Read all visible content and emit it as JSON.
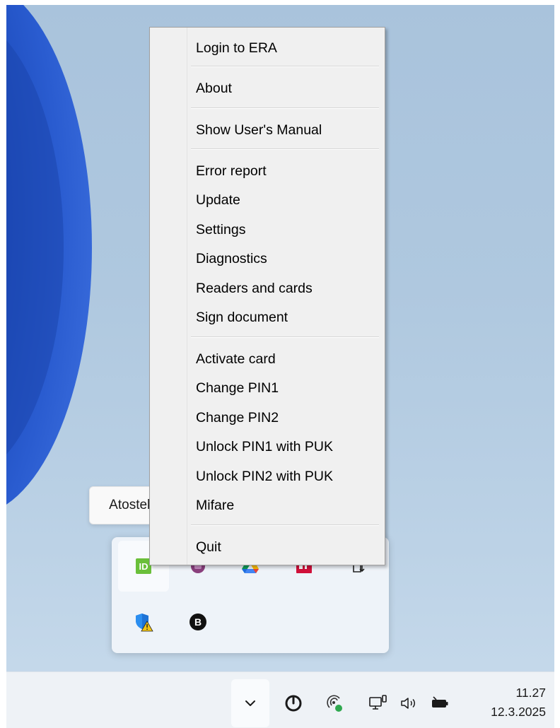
{
  "context_menu": {
    "items": [
      {
        "label": "Login to ERA"
      },
      {
        "label": "About"
      },
      {
        "label": "Show User's Manual"
      },
      {
        "label": "Error report"
      },
      {
        "label": "Update"
      },
      {
        "label": "Settings"
      },
      {
        "label": "Diagnostics"
      },
      {
        "label": "Readers and cards"
      },
      {
        "label": "Sign document"
      },
      {
        "label": "Activate card"
      },
      {
        "label": "Change PIN1"
      },
      {
        "label": "Change PIN2"
      },
      {
        "label": "Unlock PIN1 with PUK"
      },
      {
        "label": "Unlock PIN2 with PUK"
      },
      {
        "label": "Mifare"
      },
      {
        "label": "Quit"
      }
    ]
  },
  "tooltip": {
    "text": "Atostek ID"
  },
  "tray_flyout": {
    "icons": [
      {
        "name": "atostek-id-icon",
        "glyph": "ID",
        "color": "#6abf3a",
        "hovered": true
      },
      {
        "name": "purple-app-icon",
        "color": "#8a3f7d"
      },
      {
        "name": "google-drive-icon"
      },
      {
        "name": "red-app-icon",
        "color": "#d0103a"
      },
      {
        "name": "device-download-icon"
      },
      {
        "name": "defender-warning-icon"
      },
      {
        "name": "b-app-icon",
        "glyph": "B"
      }
    ]
  },
  "taskbar": {
    "clock": {
      "time": "11.27",
      "date": "12.3.2025"
    },
    "tray_icons": [
      "chevron-up-icon",
      "power-app-icon",
      "network-status-icon",
      "monitor-icon",
      "speaker-icon",
      "battery-icon"
    ]
  }
}
